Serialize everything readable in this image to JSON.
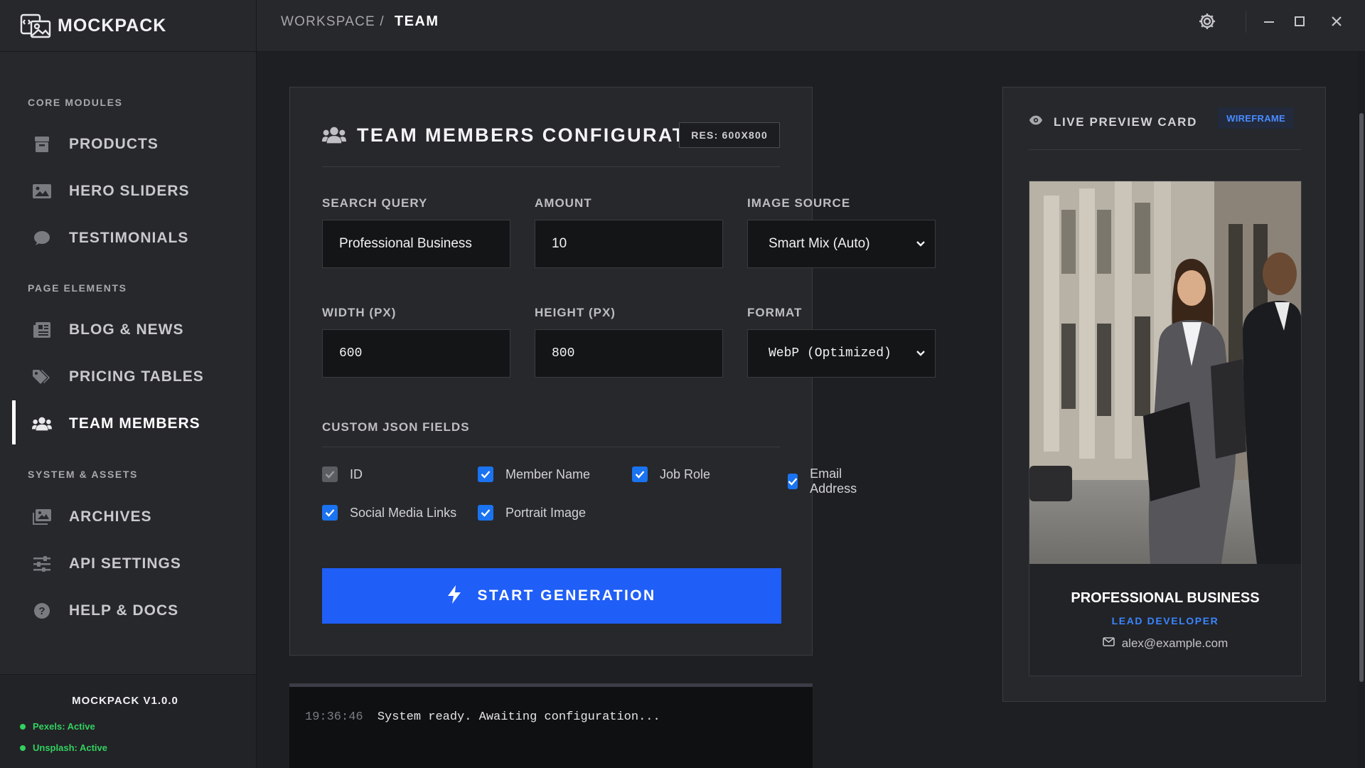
{
  "app": {
    "name": "MOCKPACK",
    "version": "MOCKPACK V1.0.0"
  },
  "sidebar": {
    "sections": [
      {
        "title": "CORE MODULES"
      },
      {
        "title": "PAGE ELEMENTS"
      },
      {
        "title": "SYSTEM & ASSETS"
      }
    ],
    "items": [
      {
        "label": "PRODUCTS",
        "icon": "box-icon"
      },
      {
        "label": "HERO SLIDERS",
        "icon": "image-icon"
      },
      {
        "label": "TESTIMONIALS",
        "icon": "chat-bubble-icon"
      },
      {
        "label": "BLOG & NEWS",
        "icon": "newspaper-icon"
      },
      {
        "label": "PRICING TABLES",
        "icon": "tags-icon"
      },
      {
        "label": "TEAM MEMBERS",
        "icon": "users-icon",
        "active": true
      },
      {
        "label": "ARCHIVES",
        "icon": "images-icon"
      },
      {
        "label": "API SETTINGS",
        "icon": "sliders-icon"
      },
      {
        "label": "HELP & DOCS",
        "icon": "question-circle-icon"
      }
    ],
    "status": [
      {
        "label": "Pexels: Active"
      },
      {
        "label": "Unsplash: Active"
      }
    ]
  },
  "topbar": {
    "breadcrumb_root": "WORKSPACE /",
    "breadcrumb_current": "TEAM"
  },
  "config": {
    "title": "TEAM MEMBERS CONFIGURATION",
    "resolution_badge": "RES: 600X800",
    "fields": {
      "search_query": {
        "label": "SEARCH QUERY",
        "value": "Professional Business"
      },
      "amount": {
        "label": "AMOUNT",
        "value": "10"
      },
      "image_source": {
        "label": "IMAGE SOURCE",
        "value": "Smart Mix (Auto)"
      },
      "width": {
        "label": "WIDTH (PX)",
        "value": "600"
      },
      "height": {
        "label": "HEIGHT (PX)",
        "value": "800"
      },
      "format": {
        "label": "FORMAT",
        "value": "WebP (Optimized)"
      }
    },
    "json_fields_label": "CUSTOM JSON FIELDS",
    "json_fields": [
      {
        "label": "ID",
        "checked": true,
        "disabled": true
      },
      {
        "label": "Member Name",
        "checked": true
      },
      {
        "label": "Job Role",
        "checked": true
      },
      {
        "label": "Email Address",
        "checked": true
      },
      {
        "label": "Social Media Links",
        "checked": true
      },
      {
        "label": "Portrait Image",
        "checked": true
      }
    ],
    "generate_label": "START GENERATION"
  },
  "console": {
    "time": "19:36:46",
    "message": "System ready. Awaiting configuration..."
  },
  "preview": {
    "title": "LIVE PREVIEW CARD",
    "badge": "WIREFRAME",
    "card": {
      "name": "PROFESSIONAL BUSINESS",
      "role": "LEAD DEVELOPER",
      "email": "alex@example.com"
    }
  },
  "colors": {
    "accent": "#1f5ef7",
    "checkbox": "#1a73f0",
    "status_active": "#33d15f",
    "role_text": "#3a86ff"
  }
}
